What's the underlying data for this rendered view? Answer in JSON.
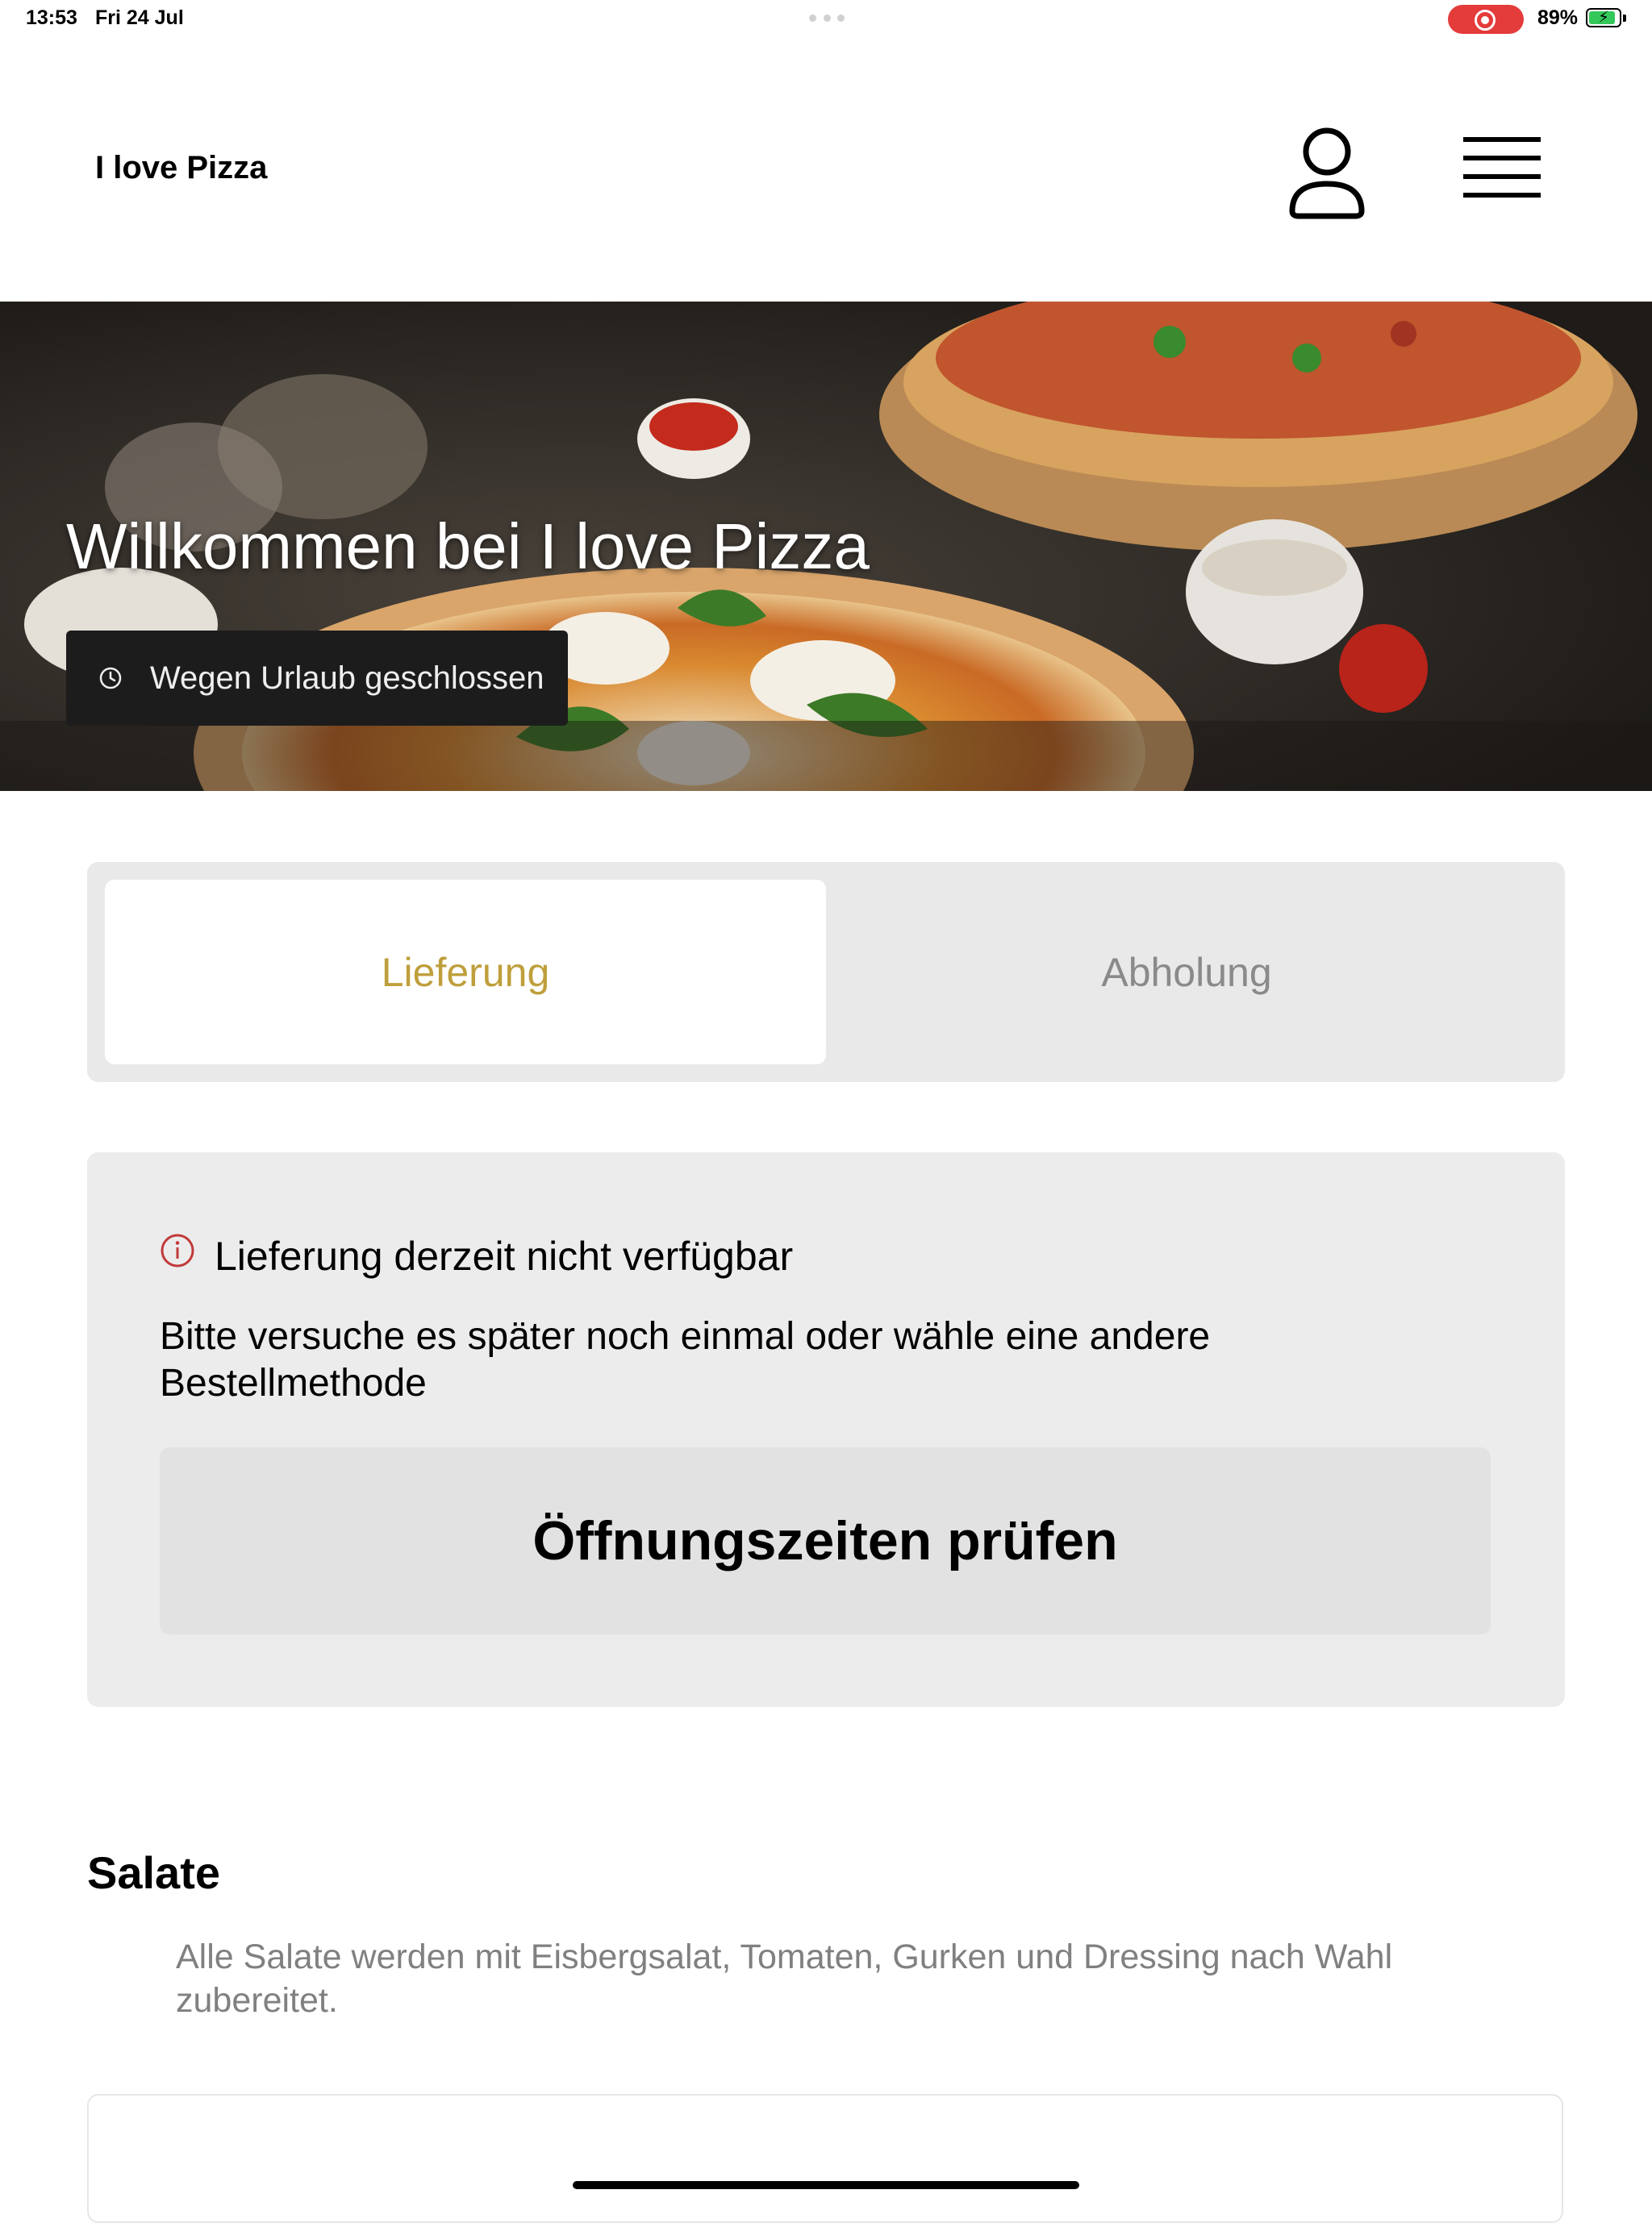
{
  "status_bar": {
    "time": "13:53",
    "date": "Fri 24 Jul",
    "battery": "89%",
    "battery_level": 0.89
  },
  "header": {
    "brand": "I love Pizza"
  },
  "hero": {
    "title": "Willkommen bei I love Pizza",
    "status_badge": "Wegen Urlaub geschlossen"
  },
  "order_method": {
    "options": [
      "Lieferung",
      "Abholung"
    ],
    "selected": "Lieferung"
  },
  "notice": {
    "title": "Lieferung derzeit nicht verfügbar",
    "text": "Bitte versuche es später noch einmal oder wähle eine andere Bestellmethode",
    "button": "Öffnungszeiten prüfen"
  },
  "section": {
    "title": "Salate",
    "description": "Alle Salate werden mit Eisbergsalat, Tomaten, Gurken und Dressing nach Wahl zubereitet."
  },
  "colors": {
    "accent": "#bf9f3c",
    "alert": "#c23a3a",
    "record": "#e43b3b",
    "battery": "#34c759"
  },
  "icons": [
    "user-icon",
    "hamburger-menu-icon",
    "clock-icon",
    "info-icon"
  ]
}
